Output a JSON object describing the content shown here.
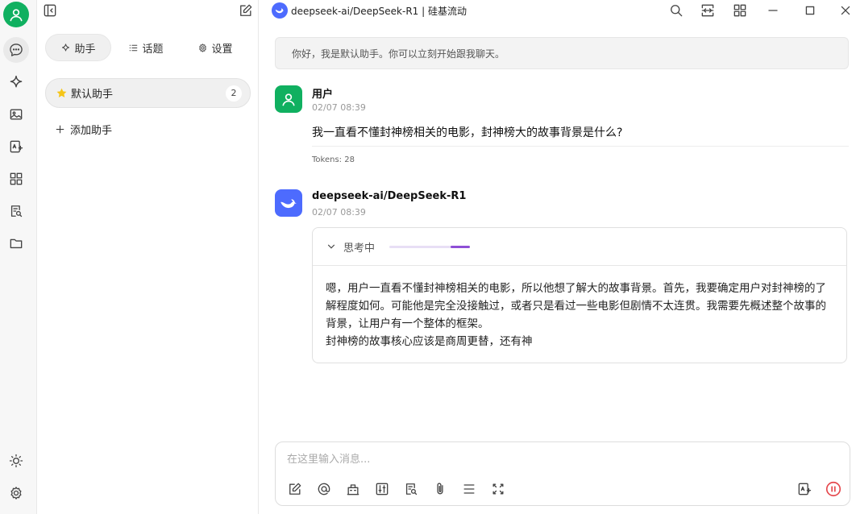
{
  "panel": {
    "tabs": [
      {
        "label": "助手",
        "icon": "sparkle-icon"
      },
      {
        "label": "话题",
        "icon": "list-icon"
      },
      {
        "label": "设置",
        "icon": "gear-icon"
      }
    ],
    "assistant_item": {
      "label": "默认助手",
      "count": "2",
      "icon": "star-icon"
    },
    "add_assistant": "添加助手"
  },
  "titlebar": {
    "title": "deepseek-ai/DeepSeek-R1 | 硅基流动"
  },
  "chat": {
    "greeting": "你好，我是默认助手。你可以立刻开始跟我聊天。",
    "user_message": {
      "name": "用户",
      "time": "02/07 08:39",
      "text": "我一直看不懂封神榜相关的电影，封神榜大的故事背景是什么?",
      "tokens": "Tokens: 28"
    },
    "assistant_message": {
      "name": "deepseek-ai/DeepSeek-R1",
      "time": "02/07 08:39",
      "thinking_label": "思考中",
      "thinking_paragraph": "嗯，用户一直看不懂封神榜相关的电影，所以他想了解大的故事背景。首先，我要确定用户对封神榜的了解程度如何。可能他是完全没接触过，或者只是看过一些电影但剧情不太连贯。我需要先概述整个故事的背景，让用户有一个整体的框架。",
      "thinking_line2": "封神榜的故事核心应该是商周更替，还有神"
    }
  },
  "input": {
    "placeholder": "在这里输入消息..."
  },
  "colors": {
    "accent_green": "#10b060",
    "deepseek_blue": "#4d6bfe",
    "thinking_purple": "#8e4fd6",
    "stop_red": "#e5484d"
  }
}
